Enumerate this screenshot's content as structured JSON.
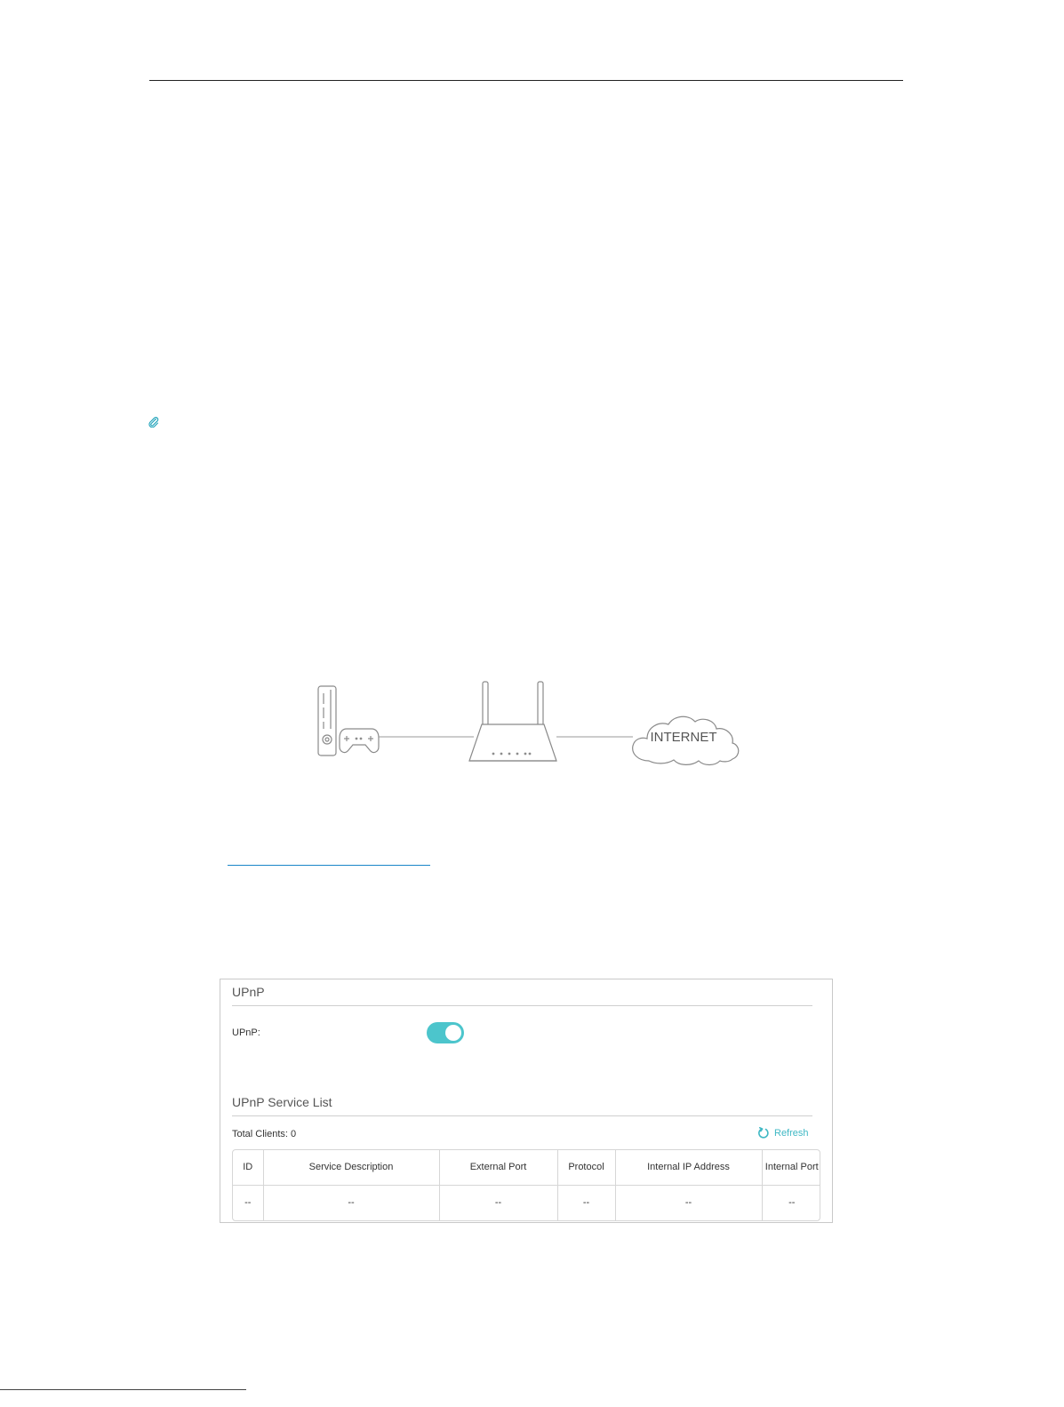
{
  "diagram": {
    "cloud_label": "INTERNET"
  },
  "upnp_panel": {
    "section_title": "UPnP",
    "upnp_label": "UPnP:",
    "upnp_enabled": true,
    "service_list_title": "UPnP Service List",
    "total_clients": "Total Clients: 0",
    "refresh_label": "Refresh",
    "accent_color": "#4cc5cc",
    "table": {
      "columns": [
        "ID",
        "Service Description",
        "External Port",
        "Protocol",
        "Internal IP Address",
        "Internal Port"
      ],
      "rows": [
        [
          "--",
          "--",
          "--",
          "--",
          "--",
          "--"
        ]
      ]
    }
  }
}
